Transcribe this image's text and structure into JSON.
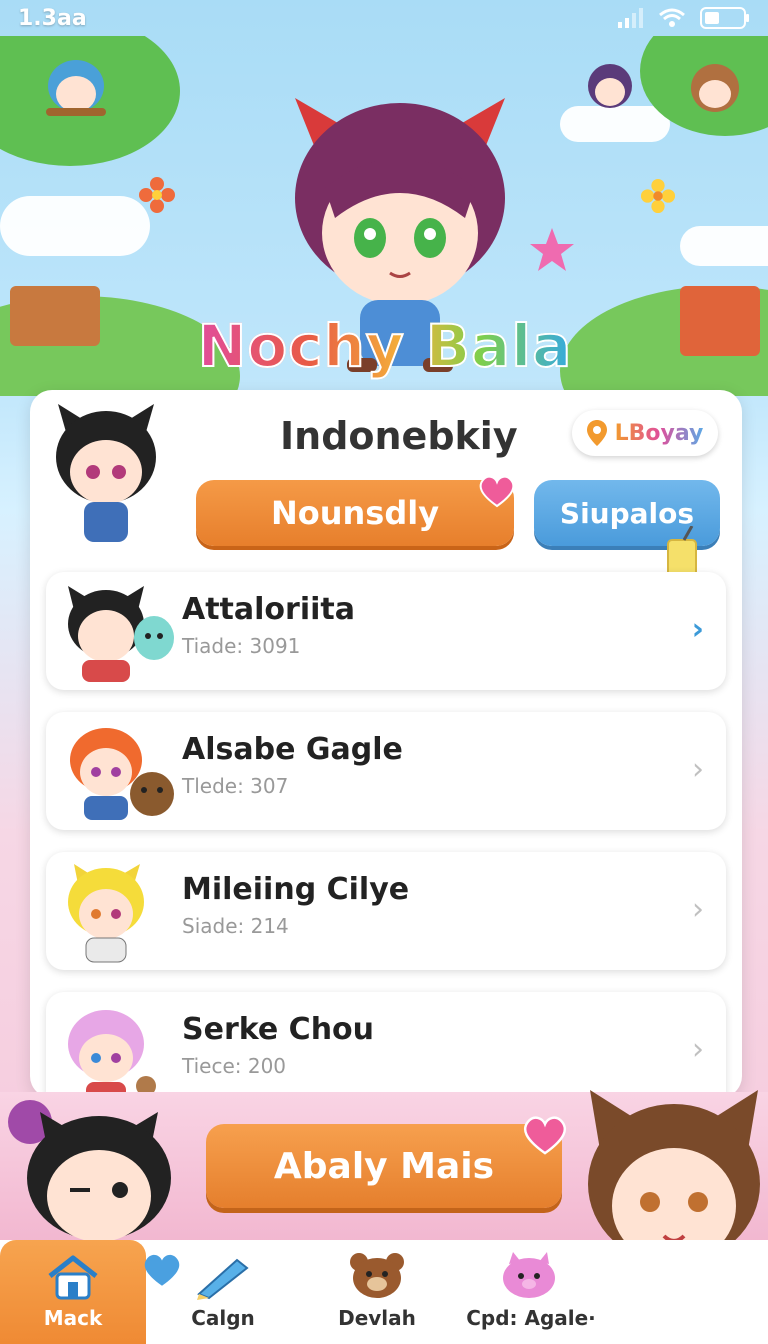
{
  "status_bar": {
    "time": "1.3aa"
  },
  "app": {
    "title": "Nochy Bala"
  },
  "card": {
    "title": "Indonebkiy",
    "location_label": "LBoyay",
    "primary_tab": "Nounsdly",
    "secondary_tab": "Siupalos"
  },
  "list": [
    {
      "name": "Attaloriita",
      "sub": "Tiade: 3091"
    },
    {
      "name": "Alsabe Gagle",
      "sub": "Tlede: 307"
    },
    {
      "name": "Mileiing Cilye",
      "sub": "Siade: 214"
    },
    {
      "name": "Serke Chou",
      "sub": "Tiece: 200"
    }
  ],
  "action_button": "Abaly Mais",
  "nav": [
    {
      "label": "Mack",
      "icon": "home-icon"
    },
    {
      "label": "Calgn",
      "icon": "pencil-icon"
    },
    {
      "label": "Devlah",
      "icon": "bear-icon"
    },
    {
      "label": "Cpd: Agale·",
      "icon": "piggy-icon"
    }
  ],
  "colors": {
    "accent_orange": "#ef8a34",
    "accent_blue": "#4a9bdb",
    "chevron_active": "#3c9ad8"
  }
}
